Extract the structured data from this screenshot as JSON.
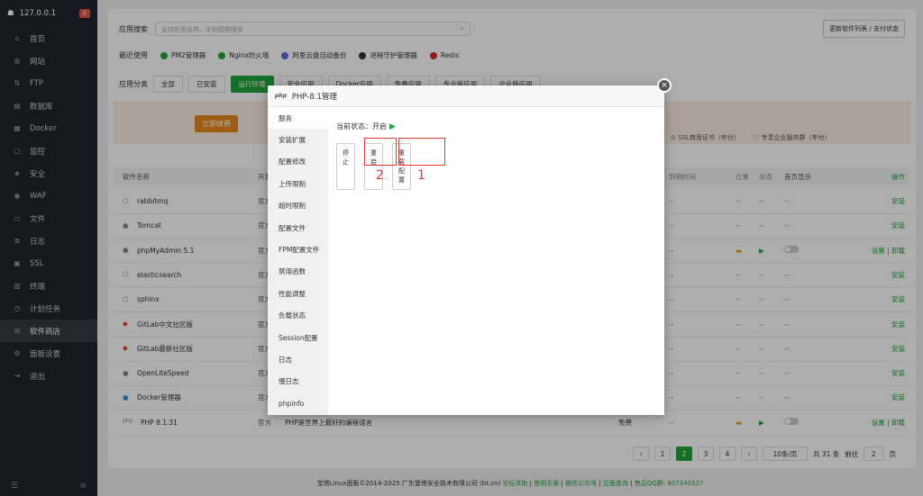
{
  "sidebar": {
    "host": "127.0.0.1",
    "badge": "0",
    "items": [
      {
        "label": "首页",
        "icon": "home-icon",
        "glyph": "⌂"
      },
      {
        "label": "网站",
        "icon": "globe-icon",
        "glyph": "◍"
      },
      {
        "label": "FTP",
        "icon": "ftp-icon",
        "glyph": "⇅"
      },
      {
        "label": "数据库",
        "icon": "database-icon",
        "glyph": "▤"
      },
      {
        "label": "Docker",
        "icon": "docker-icon",
        "glyph": "▦"
      },
      {
        "label": "监控",
        "icon": "monitor-icon",
        "glyph": "▢"
      },
      {
        "label": "安全",
        "icon": "shield-icon",
        "glyph": "◈"
      },
      {
        "label": "WAF",
        "icon": "waf-icon",
        "glyph": "◉"
      },
      {
        "label": "文件",
        "icon": "folder-icon",
        "glyph": "▭"
      },
      {
        "label": "日志",
        "icon": "log-icon",
        "glyph": "≣"
      },
      {
        "label": "SSL",
        "icon": "ssl-icon",
        "glyph": "▣"
      },
      {
        "label": "终端",
        "icon": "terminal-icon",
        "glyph": "▥"
      },
      {
        "label": "计划任务",
        "icon": "clock-icon",
        "glyph": "◷"
      },
      {
        "label": "软件商店",
        "icon": "grid-icon",
        "glyph": "⊞"
      },
      {
        "label": "面板设置",
        "icon": "gear-icon",
        "glyph": "⚙"
      },
      {
        "label": "退出",
        "icon": "logout-icon",
        "glyph": "⇥"
      }
    ],
    "active_index": 13
  },
  "search": {
    "label": "应用搜索",
    "placeholder": "支持应用名称、字段模糊搜索"
  },
  "update_button": "更新软件列表 / 支付状态",
  "recent": {
    "label": "最近使用",
    "items": [
      {
        "name": "PM2管理器",
        "color": "#20a53a"
      },
      {
        "name": "Nginx防火墙",
        "color": "#20a53a"
      },
      {
        "name": "阿里云盘自动备份",
        "color": "#5b6ee1"
      },
      {
        "name": "进程守护管理器",
        "color": "#333333"
      },
      {
        "name": "Redis",
        "color": "#d82c20"
      }
    ]
  },
  "categories": {
    "label": "应用分类",
    "items": [
      "全部",
      "已安装",
      "运行环境",
      "安全应用",
      "Docker应用",
      "免费应用",
      "专业版应用",
      "企业版应用"
    ],
    "active_index": 2
  },
  "banner": {
    "renew": "立即续费",
    "ssl": "SSL商用证书（年付）",
    "enterprise": "专享企业服务群（年付）"
  },
  "table": {
    "headers": {
      "name": "软件名称",
      "dev": "开发",
      "expire": "到期时间",
      "loc": "位置",
      "status": "状态",
      "home": "首页显示",
      "op": "操作"
    },
    "rows": [
      {
        "name": "rabbitmq",
        "dev": "官方",
        "expire": "--",
        "loc": "--",
        "status": "--",
        "home": "--",
        "op": "安装",
        "icon": "cube-icon"
      },
      {
        "name": "Tomcat",
        "dev": "官方",
        "expire": "--",
        "loc": "--",
        "status": "--",
        "home": "--",
        "op": "安装",
        "icon": "tomcat-icon"
      },
      {
        "name": "phpMyAdmin 5.1",
        "dev": "官方",
        "expire": "--",
        "loc": "folder",
        "status": "running",
        "home": "toggle",
        "op": "设置 | 卸载",
        "icon": "phpmyadmin-icon"
      },
      {
        "name": "elasticsearch",
        "dev": "官方",
        "expire": "--",
        "loc": "--",
        "status": "--",
        "home": "--",
        "op": "安装",
        "icon": "cube-icon"
      },
      {
        "name": "sphinx",
        "dev": "官方",
        "expire": "--",
        "loc": "--",
        "status": "--",
        "home": "--",
        "op": "安装",
        "icon": "cube-icon"
      },
      {
        "name": "GitLab中文社区版",
        "dev": "官方",
        "expire": "--",
        "loc": "--",
        "status": "--",
        "home": "--",
        "op": "安装",
        "icon": "gitlab-icon"
      },
      {
        "name": "GitLab最新社区版",
        "dev": "官方",
        "expire": "--",
        "loc": "--",
        "status": "--",
        "home": "--",
        "op": "安装",
        "icon": "gitlab-icon"
      },
      {
        "name": "OpenLiteSpeed",
        "dev": "官方",
        "expire": "--",
        "loc": "--",
        "status": "--",
        "home": "--",
        "op": "安装",
        "icon": "litespeed-icon"
      },
      {
        "name": "Docker管理器",
        "dev": "官方",
        "expire": "--",
        "loc": "--",
        "status": "--",
        "home": "--",
        "op": "安装",
        "icon": "docker-icon"
      },
      {
        "name": "PHP 8.1.31",
        "dev": "官方",
        "desc": "PHP是世界上最好的编程语言",
        "price": "免费",
        "expire": "--",
        "loc": "folder",
        "status": "running",
        "home": "toggle",
        "op": "设置 | 卸载",
        "icon": "php-icon"
      }
    ]
  },
  "pager": {
    "pages": [
      "1",
      "2",
      "3",
      "4"
    ],
    "current": "2",
    "per_page": "10条/页",
    "total": "共 31 条",
    "goto_label": "前往",
    "goto_value": "2",
    "page_suffix": "页"
  },
  "footer": {
    "copyright": "宝塔Linux面板©2014-2025 广东堡塔安全技术有限公司 (bt.cn)",
    "links": [
      "论坛求助",
      "使用手册",
      "微信公众号",
      "正版查询",
      "售后QQ群: 907340327"
    ]
  },
  "modal": {
    "logo": "php",
    "title": "PHP-8.1管理",
    "tabs": [
      "服务",
      "安装扩展",
      "配置修改",
      "上传限制",
      "超时限制",
      "配置文件",
      "FPM配置文件",
      "禁用函数",
      "性能调整",
      "负载状态",
      "Session配置",
      "日志",
      "慢日志",
      "phpinfo"
    ],
    "active_tab": 0,
    "status_label": "当前状态：开启",
    "buttons": {
      "stop": "停止",
      "restart": "重启",
      "reload": "重载配置"
    },
    "annotations": {
      "reload_num": "1",
      "restart_num": "2"
    }
  }
}
